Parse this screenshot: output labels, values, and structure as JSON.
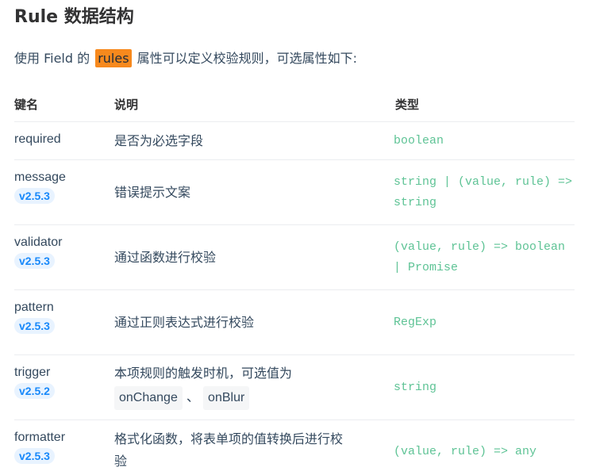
{
  "section": {
    "title": "Rule 数据结构",
    "desc_before": "使用 Field 的",
    "desc_highlight": "rules",
    "desc_after": "属性可以定义校验规则，可选属性如下:"
  },
  "table": {
    "headers": [
      "键名",
      "说明",
      "类型"
    ],
    "rows": [
      {
        "key": "required",
        "version": "",
        "desc": "是否为必选字段",
        "type_lines": [
          "boolean"
        ]
      },
      {
        "key": "message",
        "version": "v2.5.3",
        "desc": "错误提示文案",
        "type_lines": [
          "string | (value, rule) =>",
          "string"
        ]
      },
      {
        "key": "validator",
        "version": "v2.5.3",
        "desc": "通过函数进行校验",
        "type_lines": [
          "(value, rule) => boolean",
          "| Promise"
        ]
      },
      {
        "key": "pattern",
        "version": "v2.5.3",
        "desc": "通过正则表达式进行校验",
        "type_lines": [
          "RegExp"
        ]
      },
      {
        "key": "trigger",
        "version": "v2.5.2",
        "desc": "本项规则的触发时机，可选值为",
        "desc_code1": "onChange",
        "desc_sep": "、",
        "desc_code2": "onBlur",
        "type_lines": [
          "string"
        ]
      },
      {
        "key": "formatter",
        "version": "v2.5.3",
        "desc": "格式化函数，将表单项的值转换后进行校",
        "desc_line2": "验",
        "type_lines": [
          "(value, rule) => any"
        ]
      }
    ]
  },
  "colors": {
    "highlight": "#f7891d",
    "badge_bg": "#e8f3ff",
    "badge_text": "#1989fa",
    "type_text": "#42b983"
  }
}
